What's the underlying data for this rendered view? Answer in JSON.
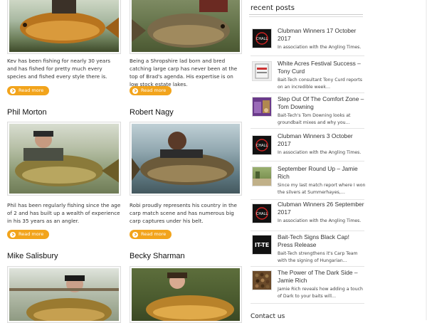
{
  "anglers": [
    {
      "name": "",
      "desc": "Kev has been fishing for nearly 30 years and has fished for pretty much every species and fished every style there is.",
      "button": "Read more"
    },
    {
      "name": "",
      "desc": "Being a Shropshire lad born and bred catching large carp has never been at the top of Brad's agenda. His expertise is on low stock estate lakes.",
      "button": "Read more"
    },
    {
      "name": "Phil Morton",
      "desc": "Phil has been regularly fishing since the age of 2 and has built up a wealth of experience in his 35 years as an angler.",
      "button": "Read more"
    },
    {
      "name": "Robert Nagy",
      "desc": "Robi proudly represents his country in the carp match scene and has numerous big carp captures under his belt.",
      "button": "Read more"
    },
    {
      "name": "Mike Salisbury",
      "desc": "",
      "button": ""
    },
    {
      "name": "Becky Sharman",
      "desc": "",
      "button": ""
    }
  ],
  "sidebar": {
    "title": "recent posts",
    "posts": [
      {
        "title": "Clubman Winners 17 October 2017",
        "excerpt": "In association with the Angling Times.",
        "thumb": "challenge-logo-icon"
      },
      {
        "title": "White Acres Festival Success – Tony Curd",
        "excerpt": "Bait-Tech consultant Tony Curd reports on an incredible week…",
        "thumb": "bait-bag-icon"
      },
      {
        "title": "Step Out Of The Comfort Zone – Tom Downing",
        "excerpt": "Bait-Tech's Tom Downing looks at groundbait mixes and why you…",
        "thumb": "groundbait-icon"
      },
      {
        "title": "Clubman Winners 3 October 2017",
        "excerpt": "In association with the Angling Times.",
        "thumb": "challenge-logo-icon"
      },
      {
        "title": "September Round Up – Jamie Rich",
        "excerpt": "Since my last match report where I won the silvers at Summerhayes,…",
        "thumb": "landscape-icon"
      },
      {
        "title": "Clubman Winners 26 September 2017",
        "excerpt": "In association with the Angling Times.",
        "thumb": "challenge-logo-icon"
      },
      {
        "title": "Bait-Tech Signs Black Cap! Press Release",
        "excerpt": "Bait-Tech strengthens it's Carp Team with the signing of Hungarian…",
        "thumb": "baittech-logo-icon"
      },
      {
        "title": "The Power of The Dark Side – Jamie Rich",
        "excerpt": "Jamie Rich reveals how adding a touch of Dark to your baits will…",
        "thumb": "pellets-icon"
      }
    ],
    "thumb_logo_text": "CHALL",
    "thumb_bt_text": "IT-TE",
    "contact_label": "Contact us"
  },
  "colors": {
    "button": "#f2a41c",
    "accent": "#cc2222"
  }
}
